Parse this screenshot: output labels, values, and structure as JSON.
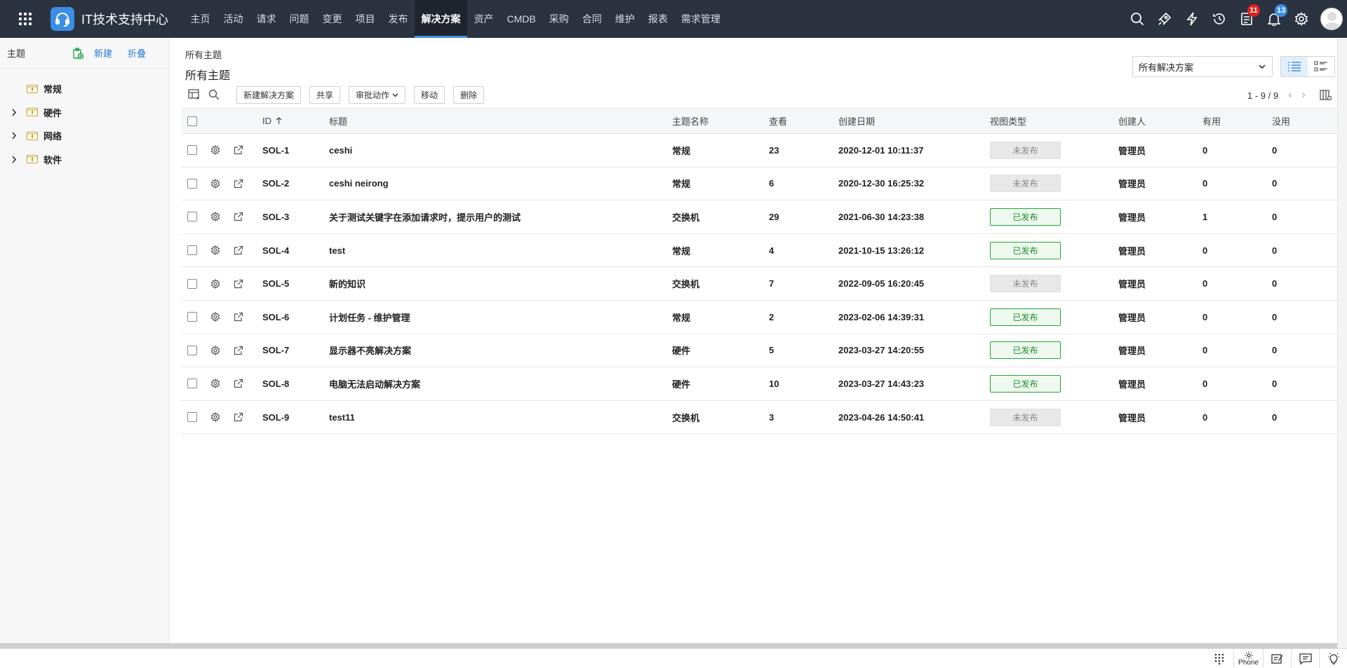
{
  "app": {
    "title": "IT技术支持中心"
  },
  "nav": {
    "items": [
      "主页",
      "活动",
      "请求",
      "问题",
      "变更",
      "项目",
      "发布",
      "解决方案",
      "资产",
      "CMDB",
      "采购",
      "合同",
      "维护",
      "报表",
      "需求管理"
    ],
    "active": "解决方案"
  },
  "header_icons": {
    "icons": [
      "search-icon",
      "rocket-icon",
      "lightning-icon",
      "history-icon",
      "task-icon",
      "bell-icon",
      "gear-icon"
    ],
    "tasks_badge": "11",
    "notifications_badge": "13"
  },
  "sidebar": {
    "title": "主题",
    "new_label": "新建",
    "collapse_label": "折叠",
    "items": [
      {
        "label": "常规",
        "expandable": false
      },
      {
        "label": "硬件",
        "expandable": true
      },
      {
        "label": "网络",
        "expandable": true
      },
      {
        "label": "软件",
        "expandable": true
      }
    ]
  },
  "main": {
    "breadcrumb": "所有主题",
    "title": "所有主题",
    "filter_select": "所有解决方案",
    "toolbar": {
      "new_solution": "新建解决方案",
      "share": "共享",
      "approval_actions": "审批动作",
      "move": "移动",
      "delete": "删除"
    },
    "pagination": "1 - 9 / 9"
  },
  "table": {
    "headers": {
      "id": "ID",
      "title": "标题",
      "topic": "主题名称",
      "views": "查看",
      "created": "创建日期",
      "view_type": "视图类型",
      "creator": "创建人",
      "useful": "有用",
      "useless": "没用"
    },
    "rows": [
      {
        "id": "SOL-1",
        "title": "ceshi",
        "topic": "常规",
        "views": "23",
        "created": "2020-12-01 10:11:37",
        "status": "未发布",
        "published": false,
        "creator": "管理员",
        "useful": "0",
        "useless": "0"
      },
      {
        "id": "SOL-2",
        "title": "ceshi neirong",
        "topic": "常规",
        "views": "6",
        "created": "2020-12-30 16:25:32",
        "status": "未发布",
        "published": false,
        "creator": "管理员",
        "useful": "0",
        "useless": "0"
      },
      {
        "id": "SOL-3",
        "title": "关于测试关键字在添加请求时，提示用户的测试",
        "topic": "交换机",
        "views": "29",
        "created": "2021-06-30 14:23:38",
        "status": "已发布",
        "published": true,
        "creator": "管理员",
        "useful": "1",
        "useless": "0"
      },
      {
        "id": "SOL-4",
        "title": "test",
        "topic": "常规",
        "views": "4",
        "created": "2021-10-15 13:26:12",
        "status": "已发布",
        "published": true,
        "creator": "管理员",
        "useful": "0",
        "useless": "0"
      },
      {
        "id": "SOL-5",
        "title": "新的知识",
        "topic": "交换机",
        "views": "7",
        "created": "2022-09-05 16:20:45",
        "status": "未发布",
        "published": false,
        "creator": "管理员",
        "useful": "0",
        "useless": "0"
      },
      {
        "id": "SOL-6",
        "title": "计划任务 - 维护管理",
        "topic": "常规",
        "views": "2",
        "created": "2023-02-06 14:39:31",
        "status": "已发布",
        "published": true,
        "creator": "管理员",
        "useful": "0",
        "useless": "0"
      },
      {
        "id": "SOL-7",
        "title": "显示器不亮解决方案",
        "topic": "硬件",
        "views": "5",
        "created": "2023-03-27 14:20:55",
        "status": "已发布",
        "published": true,
        "creator": "管理员",
        "useful": "0",
        "useless": "0"
      },
      {
        "id": "SOL-8",
        "title": "电脑无法启动解决方案",
        "topic": "硬件",
        "views": "10",
        "created": "2023-03-27 14:43:23",
        "status": "已发布",
        "published": true,
        "creator": "管理员",
        "useful": "0",
        "useless": "0"
      },
      {
        "id": "SOL-9",
        "title": "test11",
        "topic": "交换机",
        "views": "3",
        "created": "2023-04-26 14:50:41",
        "status": "未发布",
        "published": false,
        "creator": "管理员",
        "useful": "0",
        "useless": "0"
      }
    ]
  },
  "footer": {
    "phone_label": "Phone"
  },
  "colors": {
    "topbar": "#2b3240",
    "accent": "#3a8ee6",
    "published_green": "#1f8a2b",
    "badge_red": "#e02020"
  }
}
